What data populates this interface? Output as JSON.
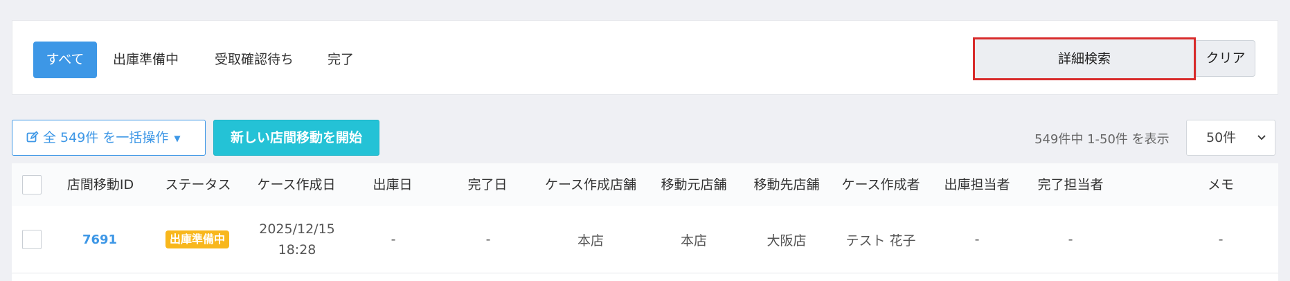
{
  "tabs": {
    "all": "すべて",
    "preparing": "出庫準備中",
    "awaiting": "受取確認待ち",
    "done": "完了"
  },
  "search": {
    "detail_label": "詳細検索",
    "clear_label": "クリア"
  },
  "toolbar": {
    "bulk_label": "全 549件 を一括操作",
    "new_label": "新しい店間移動を開始",
    "range_text": "549件中 1-50件 を表示",
    "per_page": "50件"
  },
  "table": {
    "headers": {
      "id": "店間移動ID",
      "status": "ステータス",
      "created": "ケース作成日",
      "shipped": "出庫日",
      "completed": "完了日",
      "created_store": "ケース作成店舗",
      "from_store": "移動元店舗",
      "to_store": "移動先店舗",
      "creator": "ケース作成者",
      "ship_staff": "出庫担当者",
      "complete_staff": "完了担当者",
      "memo": "メモ"
    },
    "rows": [
      {
        "id": "7691",
        "status": "出庫準備中",
        "created_date": "2025/12/15",
        "created_time": "18:28",
        "shipped": "-",
        "completed": "-",
        "created_store": "本店",
        "from_store": "本店",
        "to_store": "大阪店",
        "creator": "テスト 花子",
        "ship_staff": "-",
        "complete_staff": "-",
        "memo": "-"
      }
    ]
  },
  "colors": {
    "primary": "#3d97e6",
    "accent": "#24c2d6",
    "status_badge": "#f8b71c",
    "highlight_border": "#d82b2b"
  }
}
